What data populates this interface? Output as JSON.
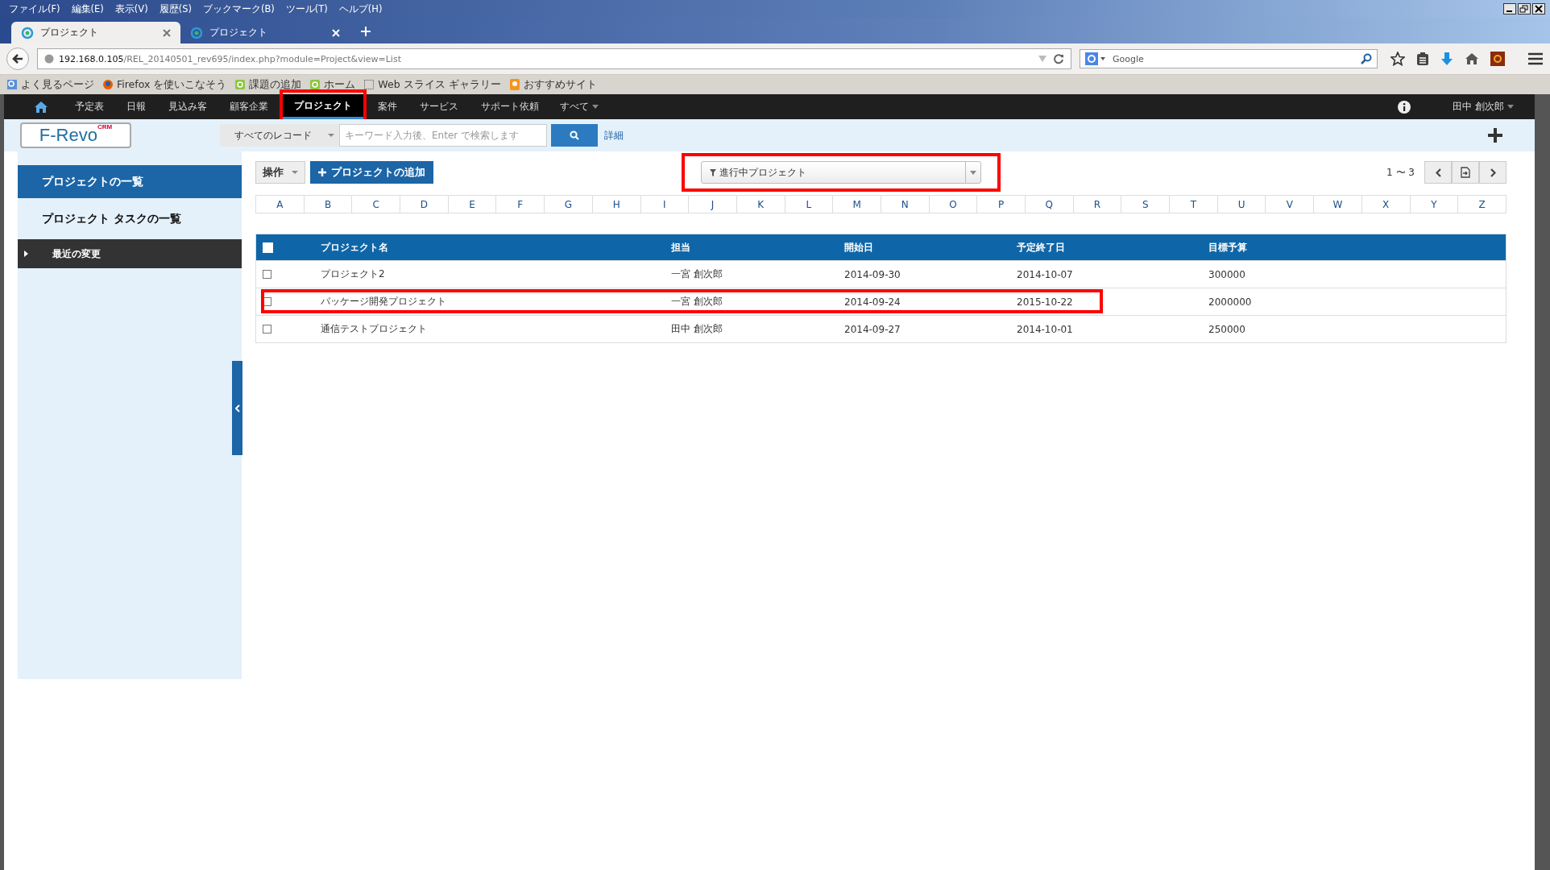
{
  "browser": {
    "menu": [
      "ファイル(F)",
      "編集(E)",
      "表示(V)",
      "履歴(S)",
      "ブックマーク(B)",
      "ツール(T)",
      "ヘルプ(H)"
    ],
    "tabs": [
      {
        "label": "プロジェクト",
        "selected": true
      },
      {
        "label": "プロジェクト",
        "selected": false
      }
    ],
    "url_host": "192.168.0.105",
    "url_path": "/REL_20140501_rev695/index.php?module=Project&view=List",
    "search_placeholder": "Google",
    "bookmarks": [
      {
        "label": "よく見るページ",
        "kind": "page"
      },
      {
        "label": "Firefox を使いこなそう",
        "kind": "firefox"
      },
      {
        "label": "課題の追加",
        "kind": "feed"
      },
      {
        "label": "ホーム",
        "kind": "feed"
      },
      {
        "label": "Web スライス ギャラリー",
        "kind": "slice"
      },
      {
        "label": "おすすめサイト",
        "kind": "bulb"
      }
    ]
  },
  "nav": {
    "items": [
      {
        "label": "予定表",
        "selected": false,
        "highlighted": false
      },
      {
        "label": "日報",
        "selected": false,
        "highlighted": false
      },
      {
        "label": "見込み客",
        "selected": false,
        "highlighted": false
      },
      {
        "label": "顧客企業",
        "selected": false,
        "highlighted": false
      },
      {
        "label": "プロジェクト",
        "selected": true,
        "highlighted": true
      },
      {
        "label": "案件",
        "selected": false,
        "highlighted": false
      },
      {
        "label": "サービス",
        "selected": false,
        "highlighted": false
      },
      {
        "label": "サポート依頼",
        "selected": false,
        "highlighted": false
      }
    ],
    "more": "すべて",
    "user": "田中 創次郎"
  },
  "toolbar": {
    "logo": "F-Revo",
    "logo_sup": "CRM",
    "scope": "すべてのレコード",
    "search_placeholder": "キーワード入力後、Enter で検索します",
    "detail_link": "詳細"
  },
  "sidebar": {
    "items": [
      {
        "label": "プロジェクトの一覧",
        "selected": true
      },
      {
        "label": "プロジェクト タスクの一覧",
        "selected": false
      }
    ],
    "recent": "最近の変更"
  },
  "actions": {
    "operation": "操作",
    "add": "プロジェクトの追加"
  },
  "filter": {
    "label": "進行中プロジェクト",
    "highlighted": true
  },
  "pager": "1 〜 3",
  "alphabet": [
    "A",
    "B",
    "C",
    "D",
    "E",
    "F",
    "G",
    "H",
    "I",
    "J",
    "K",
    "L",
    "M",
    "N",
    "O",
    "P",
    "Q",
    "R",
    "S",
    "T",
    "U",
    "V",
    "W",
    "X",
    "Y",
    "Z"
  ],
  "table": {
    "header_checked": false,
    "columns": [
      "プロジェクト名",
      "担当",
      "開始日",
      "予定終了日",
      "目標予算"
    ],
    "rows": [
      {
        "checked": false,
        "highlighted": false,
        "cells": [
          "プロジェクト2",
          "一宮 創次郎",
          "2014-09-30",
          "2014-10-07",
          "300000"
        ]
      },
      {
        "checked": false,
        "highlighted": true,
        "cells": [
          "パッケージ開発プロジェクト",
          "一宮 創次郎",
          "2014-09-24",
          "2015-10-22",
          "2000000"
        ]
      },
      {
        "checked": false,
        "highlighted": false,
        "cells": [
          "通信テストプロジェクト",
          "田中 創次郎",
          "2014-09-27",
          "2014-10-01",
          "250000"
        ]
      }
    ]
  }
}
